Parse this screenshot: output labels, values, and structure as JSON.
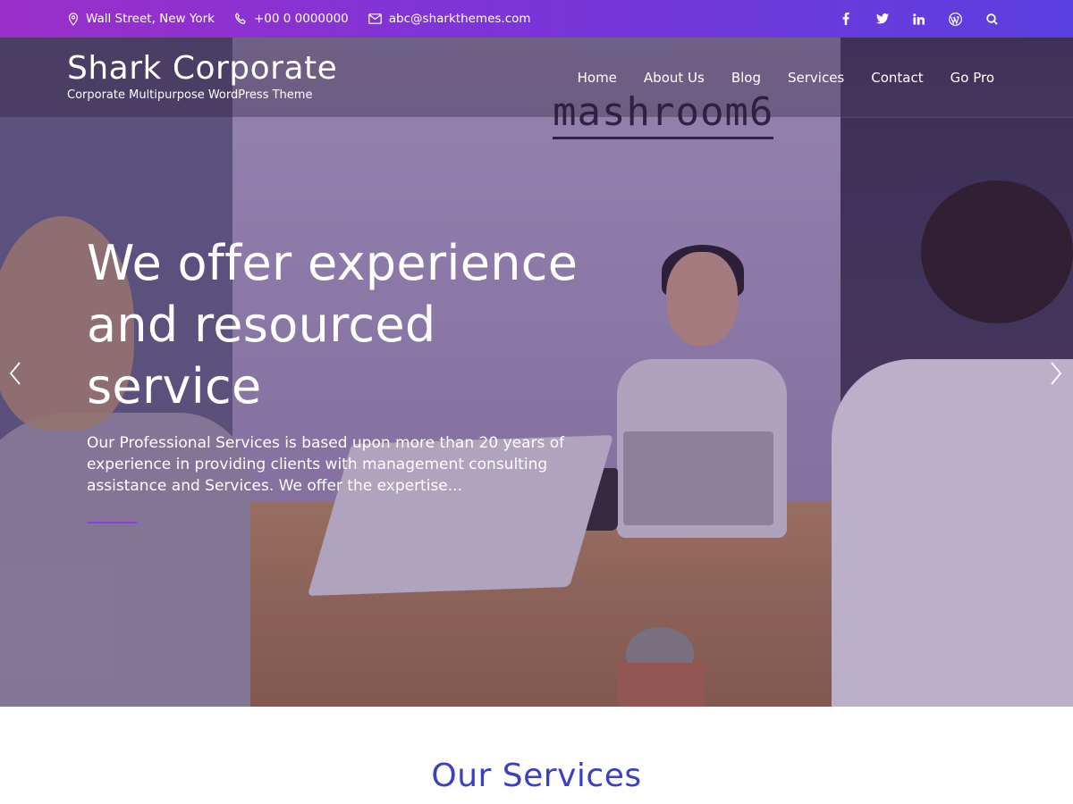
{
  "topbar": {
    "address": "Wall Street, New York",
    "phone": "+00 0 0000000",
    "email": "abc@sharkthemes.com",
    "address_icon": "map-pin-icon",
    "phone_icon": "phone-icon",
    "email_icon": "envelope-icon",
    "social": [
      {
        "name": "facebook-icon",
        "glyph": "f"
      },
      {
        "name": "twitter-icon",
        "glyph": "t"
      },
      {
        "name": "linkedin-icon",
        "glyph": "in"
      },
      {
        "name": "wordpress-icon",
        "glyph": "W"
      },
      {
        "name": "search-icon",
        "glyph": ""
      }
    ],
    "gradient_start": "#9b2fc9",
    "gradient_end": "#5a3fe0"
  },
  "header": {
    "site_title": "Shark Corporate",
    "tagline": "Corporate Multipurpose WordPress Theme",
    "nav": [
      "Home",
      "About Us",
      "Blog",
      "Services",
      "Contact",
      "Go Pro"
    ]
  },
  "hero": {
    "sign_text": "mashroom6",
    "title_lines": [
      "We offer experience",
      "and resourced",
      "service"
    ],
    "text": "Our Professional Services is based upon more than 20 years of experience in providing clients with management consulting assistance and Services. We offer the expertise...",
    "accent_line_color": "#8b3fe0"
  },
  "services": {
    "title": "Our Services",
    "title_color": "#3d3fc2"
  }
}
